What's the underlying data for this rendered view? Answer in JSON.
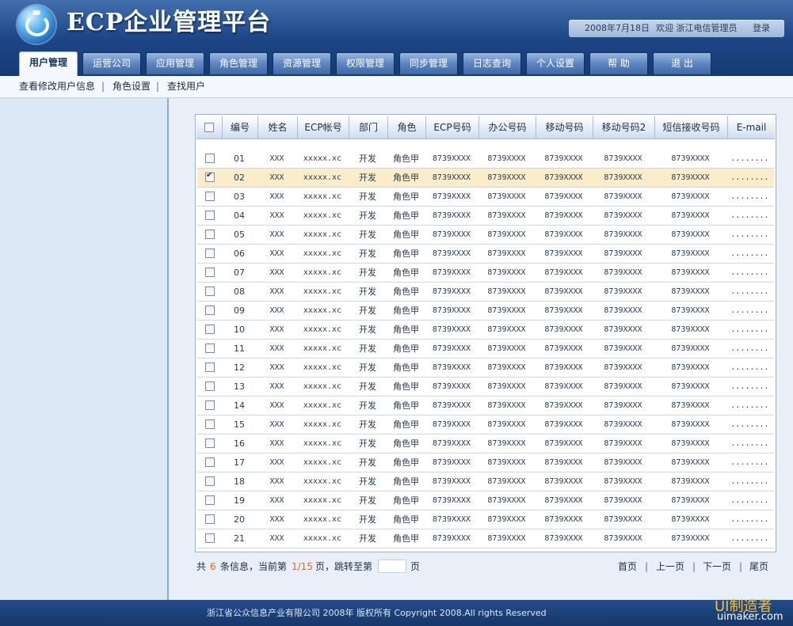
{
  "header": {
    "brand": "ECP企业管理平台",
    "date": "2008年7月18日",
    "welcome": "欢迎 浙江电信管理员",
    "login": "登录"
  },
  "tabs": [
    {
      "label": "用户管理",
      "active": true
    },
    {
      "label": "运营公司",
      "active": false
    },
    {
      "label": "应用管理",
      "active": false
    },
    {
      "label": "角色管理",
      "active": false
    },
    {
      "label": "资源管理",
      "active": false
    },
    {
      "label": "权限管理",
      "active": false
    },
    {
      "label": "同步管理",
      "active": false
    },
    {
      "label": "日志查询",
      "active": false
    },
    {
      "label": "个人设置",
      "active": false
    },
    {
      "label": "帮 助",
      "active": false
    },
    {
      "label": "退 出",
      "active": false
    }
  ],
  "subnav": {
    "links": [
      "查看修改用户信息",
      "角色设置",
      "查找用户"
    ],
    "separator": "|"
  },
  "table": {
    "columns": [
      "编号",
      "姓名",
      "ECP帐号",
      "部门",
      "角色",
      "ECP号码",
      "办公号码",
      "移动号码",
      "移动号码2",
      "短信接收号码",
      "E-mail"
    ],
    "rows": [
      {
        "id": "01",
        "name": "XXX",
        "account": "xxxxx.xc",
        "dept": "开发",
        "role": "角色甲",
        "ecp": "8739XXXX",
        "office": "8739XXXX",
        "mobile": "8739XXXX",
        "mobile2": "8739XXXX",
        "sms": "8739XXXX",
        "email": "........",
        "checked": false
      },
      {
        "id": "02",
        "name": "XXX",
        "account": "xxxxx.xc",
        "dept": "开发",
        "role": "角色甲",
        "ecp": "8739XXXX",
        "office": "8739XXXX",
        "mobile": "8739XXXX",
        "mobile2": "8739XXXX",
        "sms": "8739XXXX",
        "email": "........",
        "checked": true
      },
      {
        "id": "03",
        "name": "XXX",
        "account": "xxxxx.xc",
        "dept": "开发",
        "role": "角色甲",
        "ecp": "8739XXXX",
        "office": "8739XXXX",
        "mobile": "8739XXXX",
        "mobile2": "8739XXXX",
        "sms": "8739XXXX",
        "email": "........",
        "checked": false
      },
      {
        "id": "04",
        "name": "XXX",
        "account": "xxxxx.xc",
        "dept": "开发",
        "role": "角色甲",
        "ecp": "8739XXXX",
        "office": "8739XXXX",
        "mobile": "8739XXXX",
        "mobile2": "8739XXXX",
        "sms": "8739XXXX",
        "email": "........",
        "checked": false
      },
      {
        "id": "05",
        "name": "XXX",
        "account": "xxxxx.xc",
        "dept": "开发",
        "role": "角色甲",
        "ecp": "8739XXXX",
        "office": "8739XXXX",
        "mobile": "8739XXXX",
        "mobile2": "8739XXXX",
        "sms": "8739XXXX",
        "email": "........",
        "checked": false
      },
      {
        "id": "06",
        "name": "XXX",
        "account": "xxxxx.xc",
        "dept": "开发",
        "role": "角色甲",
        "ecp": "8739XXXX",
        "office": "8739XXXX",
        "mobile": "8739XXXX",
        "mobile2": "8739XXXX",
        "sms": "8739XXXX",
        "email": "........",
        "checked": false
      },
      {
        "id": "07",
        "name": "XXX",
        "account": "xxxxx.xc",
        "dept": "开发",
        "role": "角色甲",
        "ecp": "8739XXXX",
        "office": "8739XXXX",
        "mobile": "8739XXXX",
        "mobile2": "8739XXXX",
        "sms": "8739XXXX",
        "email": "........",
        "checked": false
      },
      {
        "id": "08",
        "name": "XXX",
        "account": "xxxxx.xc",
        "dept": "开发",
        "role": "角色甲",
        "ecp": "8739XXXX",
        "office": "8739XXXX",
        "mobile": "8739XXXX",
        "mobile2": "8739XXXX",
        "sms": "8739XXXX",
        "email": "........",
        "checked": false
      },
      {
        "id": "09",
        "name": "XXX",
        "account": "xxxxx.xc",
        "dept": "开发",
        "role": "角色甲",
        "ecp": "8739XXXX",
        "office": "8739XXXX",
        "mobile": "8739XXXX",
        "mobile2": "8739XXXX",
        "sms": "8739XXXX",
        "email": "........",
        "checked": false
      },
      {
        "id": "10",
        "name": "XXX",
        "account": "xxxxx.xc",
        "dept": "开发",
        "role": "角色甲",
        "ecp": "8739XXXX",
        "office": "8739XXXX",
        "mobile": "8739XXXX",
        "mobile2": "8739XXXX",
        "sms": "8739XXXX",
        "email": "........",
        "checked": false
      },
      {
        "id": "11",
        "name": "XXX",
        "account": "xxxxx.xc",
        "dept": "开发",
        "role": "角色甲",
        "ecp": "8739XXXX",
        "office": "8739XXXX",
        "mobile": "8739XXXX",
        "mobile2": "8739XXXX",
        "sms": "8739XXXX",
        "email": "........",
        "checked": false
      },
      {
        "id": "12",
        "name": "XXX",
        "account": "xxxxx.xc",
        "dept": "开发",
        "role": "角色甲",
        "ecp": "8739XXXX",
        "office": "8739XXXX",
        "mobile": "8739XXXX",
        "mobile2": "8739XXXX",
        "sms": "8739XXXX",
        "email": "........",
        "checked": false
      },
      {
        "id": "13",
        "name": "XXX",
        "account": "xxxxx.xc",
        "dept": "开发",
        "role": "角色甲",
        "ecp": "8739XXXX",
        "office": "8739XXXX",
        "mobile": "8739XXXX",
        "mobile2": "8739XXXX",
        "sms": "8739XXXX",
        "email": "........",
        "checked": false
      },
      {
        "id": "14",
        "name": "XXX",
        "account": "xxxxx.xc",
        "dept": "开发",
        "role": "角色甲",
        "ecp": "8739XXXX",
        "office": "8739XXXX",
        "mobile": "8739XXXX",
        "mobile2": "8739XXXX",
        "sms": "8739XXXX",
        "email": "........",
        "checked": false
      },
      {
        "id": "15",
        "name": "XXX",
        "account": "xxxxx.xc",
        "dept": "开发",
        "role": "角色甲",
        "ecp": "8739XXXX",
        "office": "8739XXXX",
        "mobile": "8739XXXX",
        "mobile2": "8739XXXX",
        "sms": "8739XXXX",
        "email": "........",
        "checked": false
      },
      {
        "id": "16",
        "name": "XXX",
        "account": "xxxxx.xc",
        "dept": "开发",
        "role": "角色甲",
        "ecp": "8739XXXX",
        "office": "8739XXXX",
        "mobile": "8739XXXX",
        "mobile2": "8739XXXX",
        "sms": "8739XXXX",
        "email": "........",
        "checked": false
      },
      {
        "id": "17",
        "name": "XXX",
        "account": "xxxxx.xc",
        "dept": "开发",
        "role": "角色甲",
        "ecp": "8739XXXX",
        "office": "8739XXXX",
        "mobile": "8739XXXX",
        "mobile2": "8739XXXX",
        "sms": "8739XXXX",
        "email": "........",
        "checked": false
      },
      {
        "id": "18",
        "name": "XXX",
        "account": "xxxxx.xc",
        "dept": "开发",
        "role": "角色甲",
        "ecp": "8739XXXX",
        "office": "8739XXXX",
        "mobile": "8739XXXX",
        "mobile2": "8739XXXX",
        "sms": "8739XXXX",
        "email": "........",
        "checked": false
      },
      {
        "id": "19",
        "name": "XXX",
        "account": "xxxxx.xc",
        "dept": "开发",
        "role": "角色甲",
        "ecp": "8739XXXX",
        "office": "8739XXXX",
        "mobile": "8739XXXX",
        "mobile2": "8739XXXX",
        "sms": "8739XXXX",
        "email": "........",
        "checked": false
      },
      {
        "id": "20",
        "name": "XXX",
        "account": "xxxxx.xc",
        "dept": "开发",
        "role": "角色甲",
        "ecp": "8739XXXX",
        "office": "8739XXXX",
        "mobile": "8739XXXX",
        "mobile2": "8739XXXX",
        "sms": "8739XXXX",
        "email": "........",
        "checked": false
      },
      {
        "id": "21",
        "name": "XXX",
        "account": "xxxxx.xc",
        "dept": "开发",
        "role": "角色甲",
        "ecp": "8739XXXX",
        "office": "8739XXXX",
        "mobile": "8739XXXX",
        "mobile2": "8739XXXX",
        "sms": "8739XXXX",
        "email": "........",
        "checked": false
      }
    ]
  },
  "pager": {
    "prefix": "共",
    "count": "6",
    "mid": "条信息，当前第",
    "page": "1/15",
    "suffix": "页，跳转至第",
    "jump_value": "",
    "page_unit": "页",
    "first": "首页",
    "prev": "上一页",
    "next": "下一页",
    "last": "尾页",
    "separator": "|"
  },
  "footer": {
    "text": "浙江省公众信息产业有限公司 2008年 版权所有 Copyright 2008.All rights Reserved",
    "watermark": "UI制造者",
    "watermark_url": "uimaker.com"
  },
  "colors": {
    "header": "#1d4585",
    "selected_row": "#fbedc9",
    "accent_orange": "#e06a15"
  },
  "icons": {
    "logo": "ecp-logo-icon",
    "checkbox": "checkbox-icon"
  }
}
